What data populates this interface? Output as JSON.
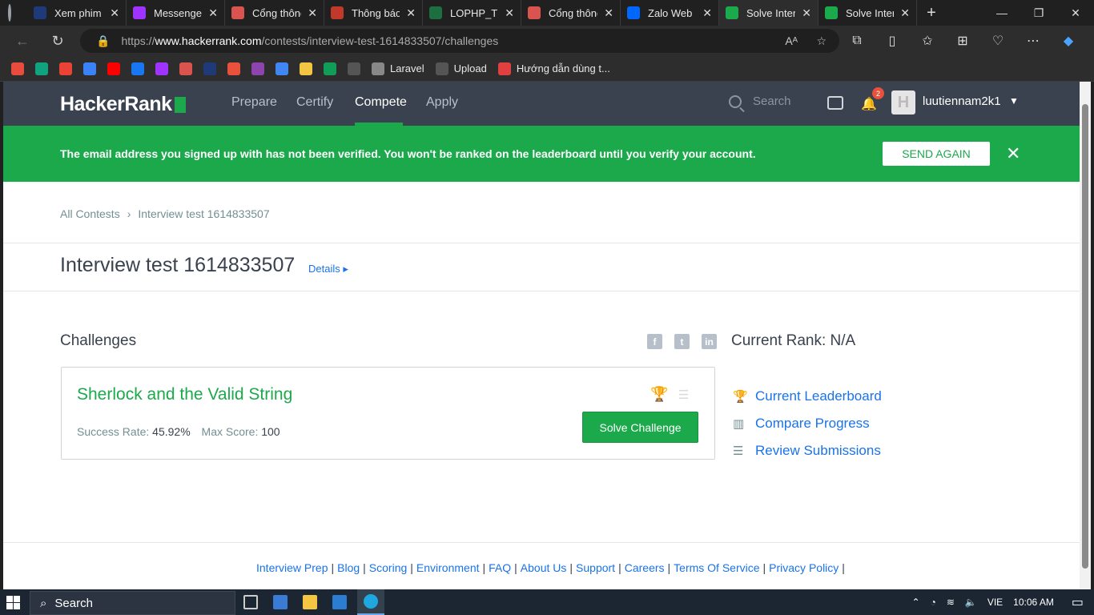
{
  "browser": {
    "tabs": [
      {
        "title": "Xem phim",
        "favicon": "film-favicon",
        "color": "#1e3a78"
      },
      {
        "title": "Messenger",
        "favicon": "messenger-favicon",
        "color": "#a033ff"
      },
      {
        "title": "Cổng thông",
        "favicon": "portal-favicon",
        "color": "#d9534f"
      },
      {
        "title": "Thông báo",
        "favicon": "portal-favicon",
        "color": "#c0392b"
      },
      {
        "title": "LOPHP_TKI",
        "favicon": "excel-favicon",
        "color": "#1d6f42"
      },
      {
        "title": "Cổng thông",
        "favicon": "portal-favicon",
        "color": "#d9534f"
      },
      {
        "title": "Zalo Web",
        "favicon": "zalo-favicon",
        "color": "#0068ff"
      },
      {
        "title": "Solve Inter",
        "favicon": "hackerrank-favicon",
        "color": "#1ba94c"
      },
      {
        "title": "Solve Inter",
        "favicon": "hackerrank-favicon",
        "color": "#1ba94c"
      }
    ],
    "url_prefix": "https://",
    "url_host": "www.hackerrank.com",
    "url_path": "/contests/interview-test-1614833507/challenges",
    "bookmarks": [
      {
        "label": "",
        "color": "#e74c3c"
      },
      {
        "label": "",
        "color": "#10a37f"
      },
      {
        "label": "",
        "color": "#ea4335"
      },
      {
        "label": "",
        "color": "#3b82f6"
      },
      {
        "label": "",
        "color": "#ff0000"
      },
      {
        "label": "",
        "color": "#1877f2"
      },
      {
        "label": "",
        "color": "#a033ff"
      },
      {
        "label": "",
        "color": "#d9534f"
      },
      {
        "label": "",
        "color": "#1e3a78"
      },
      {
        "label": "",
        "color": "#e8513b"
      },
      {
        "label": "",
        "color": "#8e44ad"
      },
      {
        "label": "",
        "color": "#4285f4"
      },
      {
        "label": "",
        "color": "#f4c542"
      },
      {
        "label": "",
        "color": "#0f9d58"
      },
      {
        "label": "",
        "color": "#555555"
      },
      {
        "label": "Laravel",
        "color": "#888888"
      },
      {
        "label": "Upload",
        "color": "#555555"
      },
      {
        "label": "Hướng dẫn dùng t...",
        "color": "#e04040"
      }
    ]
  },
  "nav": {
    "logo": "HackerRank",
    "links": [
      "Prepare",
      "Certify",
      "Compete",
      "Apply"
    ],
    "active": "Compete",
    "search_placeholder": "Search",
    "notification_count": "2",
    "username": "luutiennam2k1"
  },
  "banner": {
    "message": "The email address you signed up with has not been verified. You won't be ranked on the leaderboard until you verify your account.",
    "button": "SEND AGAIN",
    "color": "#1ba94c"
  },
  "breadcrumb": {
    "root": "All Contests",
    "current": "Interview test 1614833507"
  },
  "contest": {
    "title": "Interview test 1614833507",
    "details_link": "Details ▸"
  },
  "challenges": {
    "heading": "Challenges",
    "items": [
      {
        "name": "Sherlock and the Valid String",
        "success_rate_label": "Success Rate:",
        "success_rate": "45.92%",
        "max_score_label": "Max Score:",
        "max_score": "100",
        "button": "Solve Challenge"
      }
    ]
  },
  "sidebar": {
    "rank": "Current Rank: N/A",
    "links": [
      "Current Leaderboard",
      "Compare Progress",
      "Review Submissions"
    ]
  },
  "footer": {
    "links": [
      "Interview Prep",
      "Blog",
      "Scoring",
      "Environment",
      "FAQ",
      "About Us",
      "Support",
      "Careers",
      "Terms Of Service",
      "Privacy Policy"
    ]
  },
  "taskbar": {
    "search": "Search",
    "language": "VIE",
    "time": "10:06 AM"
  }
}
